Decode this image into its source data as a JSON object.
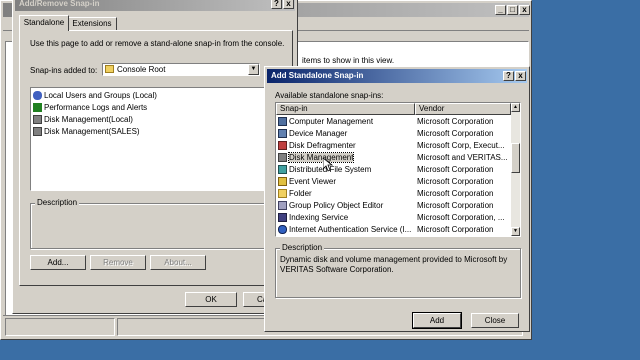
{
  "console_window": {
    "list_hint": "items to show in this view."
  },
  "add_remove_dialog": {
    "title": "Add/Remove Snap-in",
    "tabs": [
      {
        "label": "Standalone"
      },
      {
        "label": "Extensions"
      }
    ],
    "instruction": "Use this page to add or remove a stand-alone snap-in from the console.",
    "snapins_added_label": "Snap-ins added to:",
    "snapins_added_value": "Console Root",
    "added_items": [
      {
        "label": "Local Users and Groups (Local)",
        "icon": "users-icon"
      },
      {
        "label": "Performance Logs and Alerts",
        "icon": "performance-icon"
      },
      {
        "label": "Disk Management(Local)",
        "icon": "disk-icon"
      },
      {
        "label": "Disk Management(SALES)",
        "icon": "disk-icon"
      }
    ],
    "description_label": "Description",
    "buttons": {
      "add": "Add...",
      "remove": "Remove",
      "about": "About...",
      "ok": "OK",
      "cancel": "Ca"
    }
  },
  "add_standalone_dialog": {
    "title": "Add Standalone Snap-in",
    "available_label": "Available standalone snap-ins:",
    "columns": {
      "snapin": "Snap-in",
      "vendor": "Vendor"
    },
    "rows": [
      {
        "name": "Computer Management",
        "vendor": "Microsoft Corporation",
        "icon": "computer-icon"
      },
      {
        "name": "Device Manager",
        "vendor": "Microsoft Corporation",
        "icon": "device-icon"
      },
      {
        "name": "Disk Defragmenter",
        "vendor": "Microsoft Corp, Execut...",
        "icon": "defrag-icon"
      },
      {
        "name": "Disk Management",
        "vendor": "Microsoft and VERITAS...",
        "icon": "disk-icon"
      },
      {
        "name": "Distributed File System",
        "vendor": "Microsoft Corporation",
        "icon": "dfs-icon"
      },
      {
        "name": "Event Viewer",
        "vendor": "Microsoft Corporation",
        "icon": "event-icon"
      },
      {
        "name": "Folder",
        "vendor": "Microsoft Corporation",
        "icon": "folder-icon"
      },
      {
        "name": "Group Policy Object Editor",
        "vendor": "Microsoft Corporation",
        "icon": "policy-icon"
      },
      {
        "name": "Indexing Service",
        "vendor": "Microsoft Corporation, ...",
        "icon": "index-icon"
      },
      {
        "name": "Internet Authentication Service (I...",
        "vendor": "Microsoft Corporation",
        "icon": "ias-icon"
      }
    ],
    "selected_index": 3,
    "description_label": "Description",
    "description_text": "Dynamic disk and volume management provided to Microsoft by VERITAS Software Corporation.",
    "buttons": {
      "add": "Add",
      "close": "Close"
    }
  },
  "colors": {
    "desktop": "#3a6ea5",
    "face": "#d4d0c8",
    "title_active": "#0a246a"
  }
}
